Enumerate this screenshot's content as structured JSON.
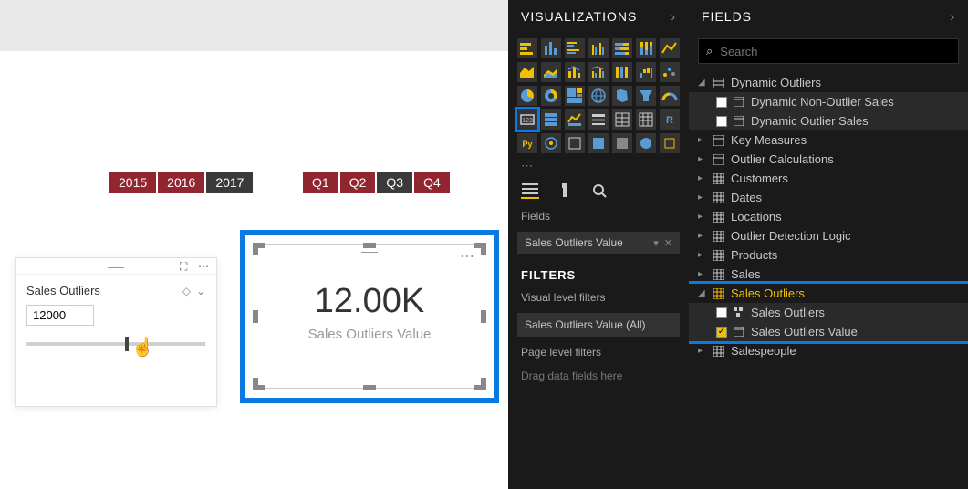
{
  "segments": {
    "years": [
      {
        "label": "2015",
        "variant": "red"
      },
      {
        "label": "2016",
        "variant": "red"
      },
      {
        "label": "2017",
        "variant": "dark"
      }
    ],
    "quarters": [
      {
        "label": "Q1",
        "variant": "red"
      },
      {
        "label": "Q2",
        "variant": "red"
      },
      {
        "label": "Q3",
        "variant": "dark"
      },
      {
        "label": "Q4",
        "variant": "red"
      }
    ]
  },
  "slicer": {
    "title": "Sales Outliers",
    "value": "12000"
  },
  "card": {
    "value": "12.00K",
    "label": "Sales Outliers Value"
  },
  "viz_panel": {
    "title": "VISUALIZATIONS",
    "fields_label": "Fields",
    "well_item": "Sales Outliers Value",
    "filters_title": "FILTERS",
    "visual_filters_label": "Visual level filters",
    "filter_item": "Sales Outliers Value (All)",
    "page_filters_label": "Page level filters",
    "drag_hint": "Drag data fields here"
  },
  "fields_panel": {
    "title": "FIELDS",
    "search_placeholder": "Search",
    "tables": {
      "dynamic_outliers": {
        "label": "Dynamic Outliers",
        "children": [
          "Dynamic Non-Outlier Sales",
          "Dynamic Outlier Sales"
        ]
      },
      "key_measures": "Key Measures",
      "outlier_calculations": "Outlier Calculations",
      "customers": "Customers",
      "dates": "Dates",
      "locations": "Locations",
      "outlier_detection": "Outlier Detection Logic",
      "products": "Products",
      "sales": "Sales",
      "sales_outliers": {
        "label": "Sales Outliers",
        "children": [
          {
            "label": "Sales Outliers",
            "checked": false
          },
          {
            "label": "Sales Outliers Value",
            "checked": true
          }
        ]
      },
      "salespeople": "Salespeople"
    }
  }
}
